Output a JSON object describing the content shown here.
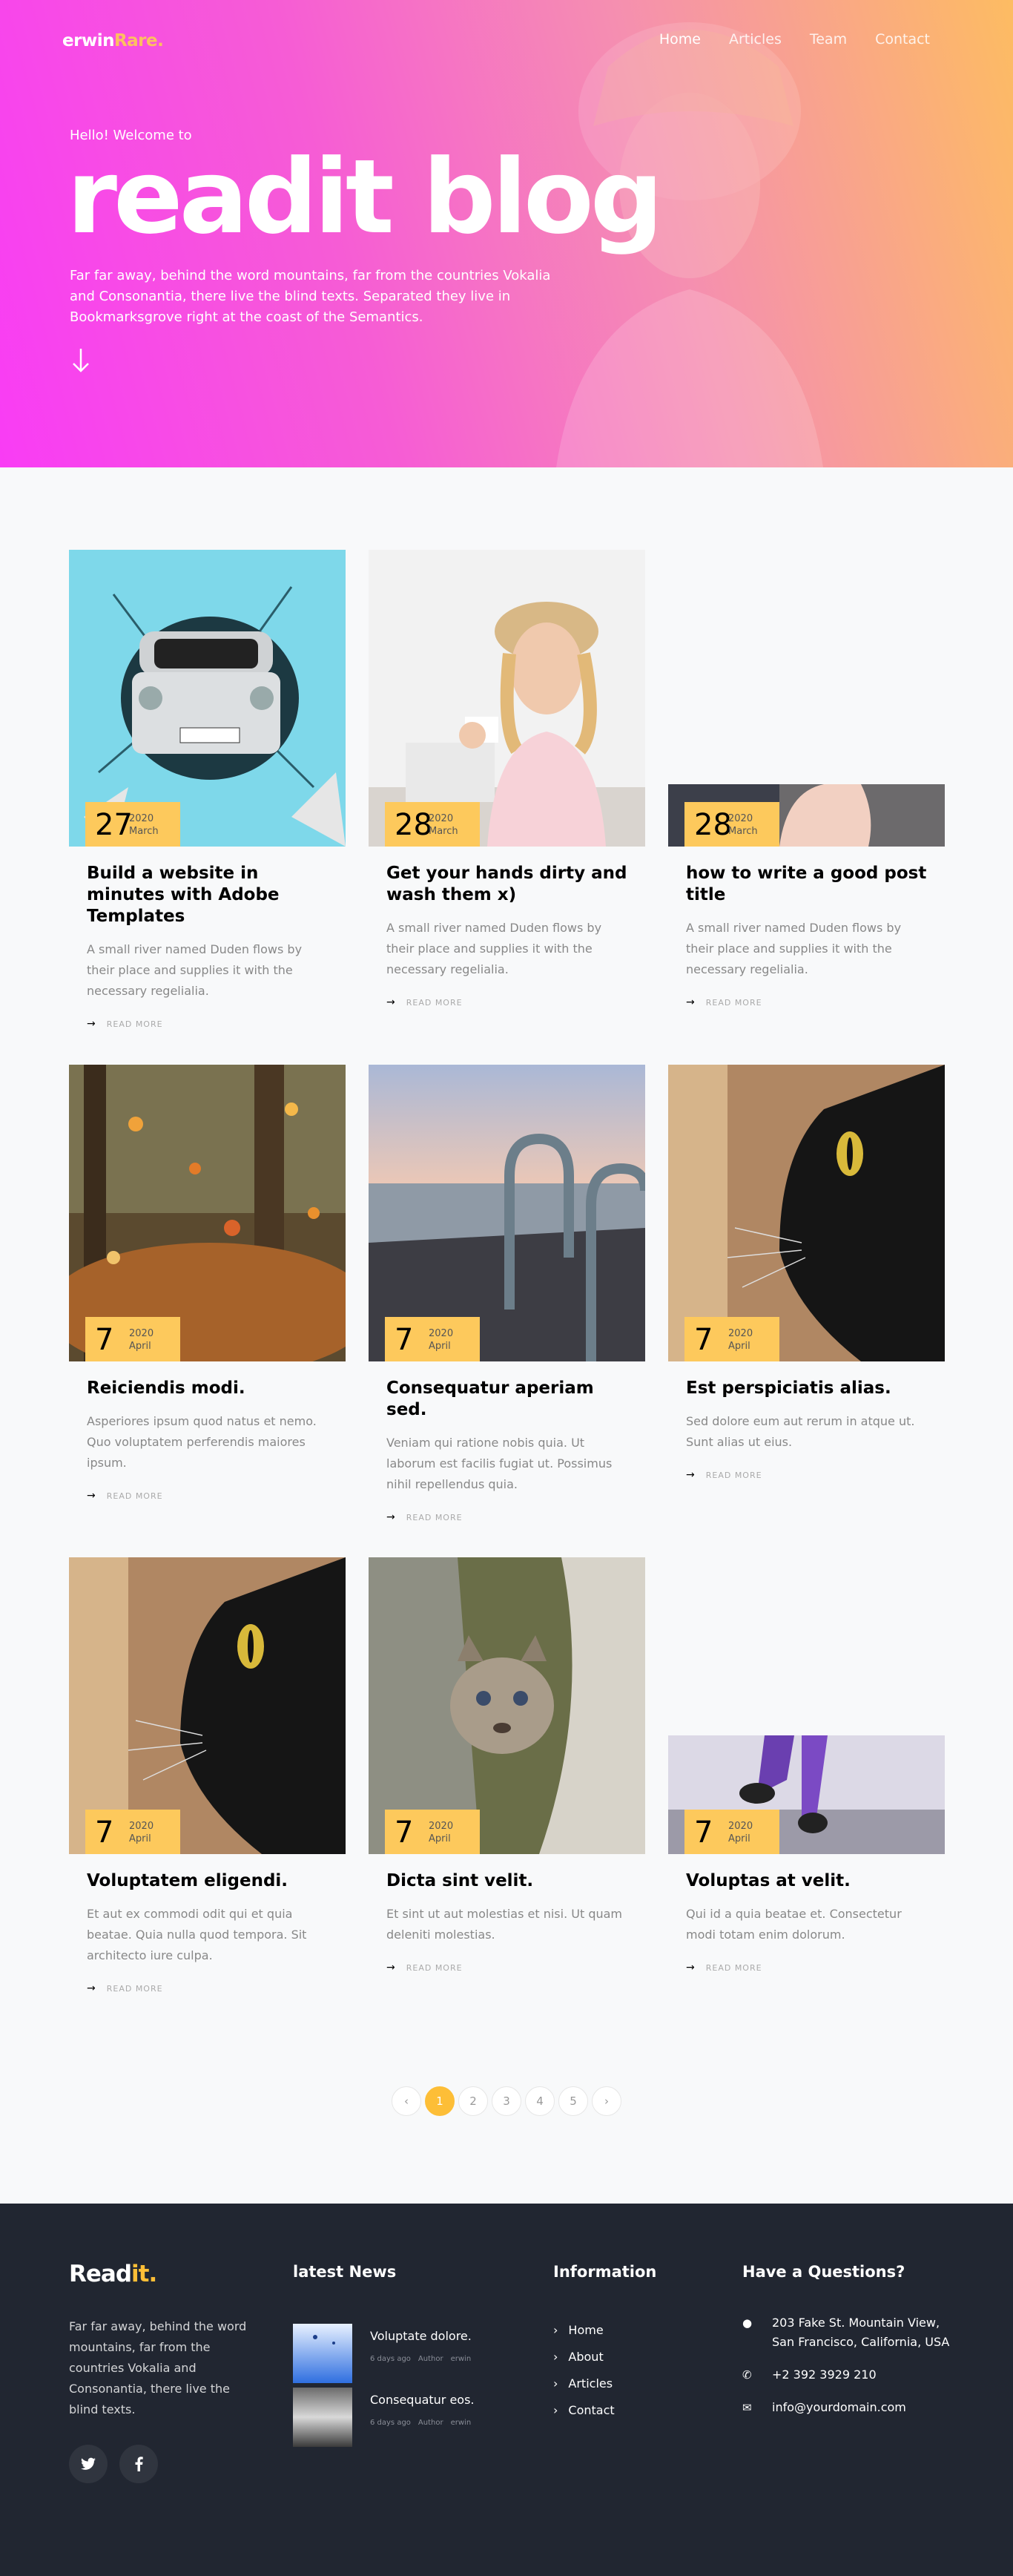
{
  "nav": {
    "logo_main": "erwin",
    "logo_accent": "Rare.",
    "items": [
      "Home",
      "Articles",
      "Team",
      "Contact"
    ]
  },
  "hero": {
    "welcome": "Hello! Welcome to",
    "title": "readit blog",
    "text": "Far far away, behind the word mountains, far from the countries Vokalia and Consonantia, there live the blind texts. Separated they live in Bookmarksgrove right at the coast of the Semantics."
  },
  "posts": [
    {
      "day": "27",
      "year": "2020",
      "month": "March",
      "title": "Build a website in minutes with Adobe Templates",
      "excerpt": "A small river named Duden flows by their place and supplies it with the necessary regelialia.",
      "more": "READ MORE",
      "image": "car-wall-image"
    },
    {
      "day": "28",
      "year": "2020",
      "month": "March",
      "title": "Get your hands dirty and wash them x)",
      "excerpt": "A small river named Duden flows by their place and supplies it with the necessary regelialia.",
      "more": "READ MORE",
      "image": "woman-hat-image"
    },
    {
      "day": "28",
      "year": "2020",
      "month": "March",
      "title": "how to write a good post title",
      "excerpt": "A small river named Duden flows by their place and supplies it with the necessary regelialia.",
      "more": "READ MORE",
      "image": "cropped-woman-image"
    },
    {
      "day": "7",
      "year": "2020",
      "month": "April",
      "title": "Reiciendis modi.",
      "excerpt": "Asperiores ipsum quod natus et nemo. Quo voluptatem perferendis maiores ipsum.",
      "more": "READ MORE",
      "image": "autumn-leaves-image"
    },
    {
      "day": "7",
      "year": "2020",
      "month": "April",
      "title": "Consequatur aperiam sed.",
      "excerpt": "Veniam qui ratione nobis quia. Ut laborum est facilis fugiat ut. Possimus nihil repellendus quia.",
      "more": "READ MORE",
      "image": "pier-ladder-image"
    },
    {
      "day": "7",
      "year": "2020",
      "month": "April",
      "title": "Est perspiciatis alias.",
      "excerpt": "Sed dolore eum aut rerum in atque ut. Sunt alias ut eius.",
      "more": "READ MORE",
      "image": "black-cat-image"
    },
    {
      "day": "7",
      "year": "2020",
      "month": "April",
      "title": "Voluptatem eligendi.",
      "excerpt": "Et aut ex commodi odit qui et quia beatae. Quia nulla quod tempora. Sit architecto iure culpa.",
      "more": "READ MORE",
      "image": "black-cat-image"
    },
    {
      "day": "7",
      "year": "2020",
      "month": "April",
      "title": "Dicta sint velit.",
      "excerpt": "Et sint ut aut molestias et nisi. Ut quam deleniti molestias.",
      "more": "READ MORE",
      "image": "cougar-cub-image"
    },
    {
      "day": "7",
      "year": "2020",
      "month": "April",
      "title": "Voluptas at velit.",
      "excerpt": "Qui id a quia beatae et. Consectetur modi totam enim dolorum.",
      "more": "READ MORE",
      "image": "runner-legs-image"
    }
  ],
  "pagination": {
    "prev": "‹",
    "pages": [
      "1",
      "2",
      "3",
      "4",
      "5"
    ],
    "current": "1",
    "next": "›"
  },
  "footer": {
    "logo_main": "Read",
    "logo_accent": "it.",
    "about": "Far far away, behind the word mountains, far from the countries Vokalia and Consonantia, there live the blind texts.",
    "social": [
      "twitter-icon",
      "facebook-icon"
    ],
    "news_heading": "latest News",
    "news": [
      {
        "title": "Voluptate dolore.",
        "date": "6 days ago",
        "author": "Author",
        "name": "erwin"
      },
      {
        "title": "Consequatur eos.",
        "date": "6 days ago",
        "author": "Author",
        "name": "erwin"
      }
    ],
    "info_heading": "Information",
    "info_links": [
      "Home",
      "About",
      "Articles",
      "Contact"
    ],
    "contact_heading": "Have a Questions?",
    "address": "203 Fake St. Mountain View, San Francisco, California, USA",
    "phone": "+2 392 3929 210",
    "email": "info@yourdomain.com"
  },
  "colors": {
    "accent": "#fdbe37",
    "date_badge": "#fdc95c",
    "footer_bg": "#212631",
    "hero_start": "#f93cf5",
    "hero_end": "#fdbc62"
  }
}
